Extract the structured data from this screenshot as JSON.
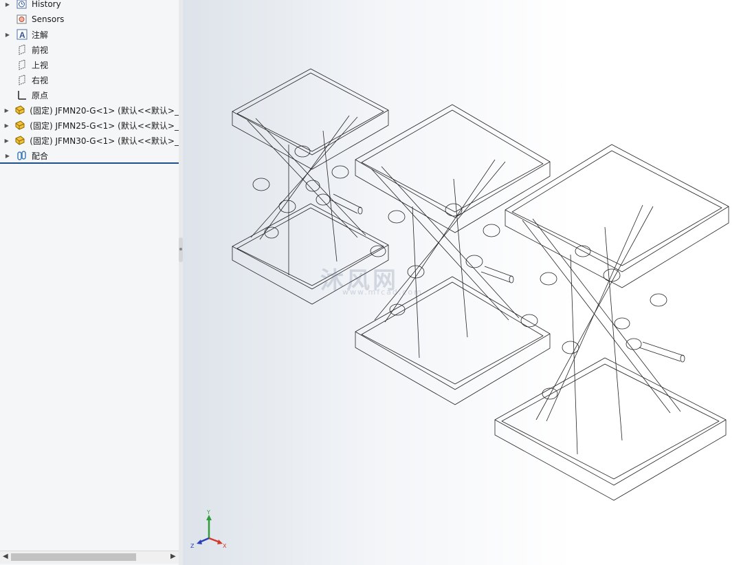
{
  "tree": {
    "items": [
      {
        "label": "History",
        "icon": "history-icon",
        "expandable": true
      },
      {
        "label": "Sensors",
        "icon": "sensor-icon",
        "expandable": false
      },
      {
        "label": "注解",
        "icon": "annotation-icon",
        "expandable": true
      },
      {
        "label": "前视",
        "icon": "plane-icon",
        "expandable": false
      },
      {
        "label": "上视",
        "icon": "plane-icon",
        "expandable": false
      },
      {
        "label": "右视",
        "icon": "plane-icon",
        "expandable": false
      },
      {
        "label": "原点",
        "icon": "origin-icon",
        "expandable": false
      },
      {
        "label": "(固定) JFMN20-G<1> (默认<<默认>_",
        "icon": "part-icon",
        "expandable": true
      },
      {
        "label": "(固定) JFMN25-G<1> (默认<<默认>_",
        "icon": "part-icon",
        "expandable": true
      },
      {
        "label": "(固定) JFMN30-G<1> (默认<<默认>_",
        "icon": "part-icon",
        "expandable": true
      },
      {
        "label": "配合",
        "icon": "mate-icon",
        "expandable": true
      }
    ]
  },
  "viewport": {
    "watermark": "沐风网",
    "watermark_sub": "www.mfcad.com",
    "triad": {
      "y": "Y",
      "x": "X",
      "z": "Z"
    }
  },
  "colors": {
    "selection_line": "#1f4e8c",
    "triad_y": "#2e9e3a",
    "triad_x": "#d23a2c",
    "triad_z": "#2a3fb8"
  }
}
